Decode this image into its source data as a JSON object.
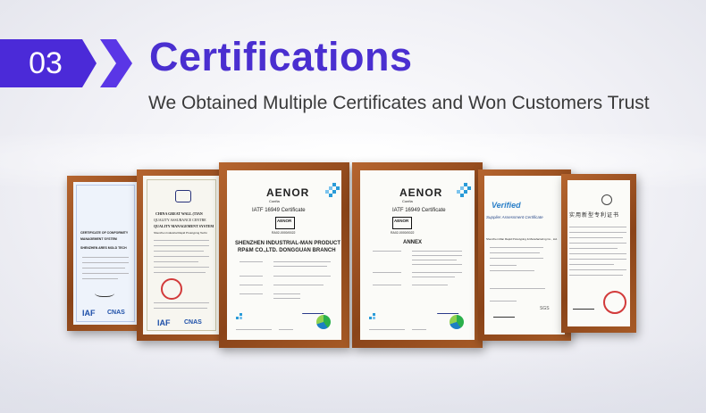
{
  "header": {
    "number": "03",
    "title": "Certifications",
    "subtitle": "We Obtained Multiple Certificates and Won Customers Trust"
  },
  "colors": {
    "accent": "#4a2fd0",
    "frame": "#8a4419",
    "badge": "#4b2ad8"
  },
  "certificates": [
    {
      "id": "cert-1",
      "heading": "CERTIFICATE OF CONFORMITY",
      "line2": "MANAGEMENT SYSTEM",
      "company": "SHENZHEN ARES MOLD TECH",
      "logos": [
        "IAF",
        "CNAS"
      ]
    },
    {
      "id": "cert-2",
      "issuer": "CHINA GREAT WALL (TIAN",
      "heading": "QUALITY ASSURANCE CENTRE",
      "line3": "QUALITY MANAGEMENT SYSTEM",
      "company": "Shenzhen Industrial Rapid Prototyping Techn",
      "logos": [
        "IAF",
        "CNAS"
      ]
    },
    {
      "id": "cert-3",
      "brand": "AENOR",
      "brand_sub": "Confía",
      "standard": "IATF 16949 Certificate",
      "seal": "AENOR",
      "code": "RA02-0000/0022",
      "company_line1": "SHENZHEN INDUSTRIAL-MAN PRODUCT",
      "company_line2": "RP&M CO.,LTD. DONGGUAN BRANCH"
    },
    {
      "id": "cert-4",
      "brand": "AENOR",
      "brand_sub": "Confía",
      "standard": "IATF 16949 Certificate",
      "seal": "AENOR",
      "code": "RA02-0000/0022",
      "annex": "ANNEX"
    },
    {
      "id": "cert-5",
      "brand": "Verified",
      "heading": "Supplier Assessment Certificate",
      "company": "Shenzhen Man Rapid Prototyping & Manufacturing Co., Ltd.",
      "mark": "SGS"
    },
    {
      "id": "cert-6",
      "heading": "实用新型专利证书"
    }
  ]
}
